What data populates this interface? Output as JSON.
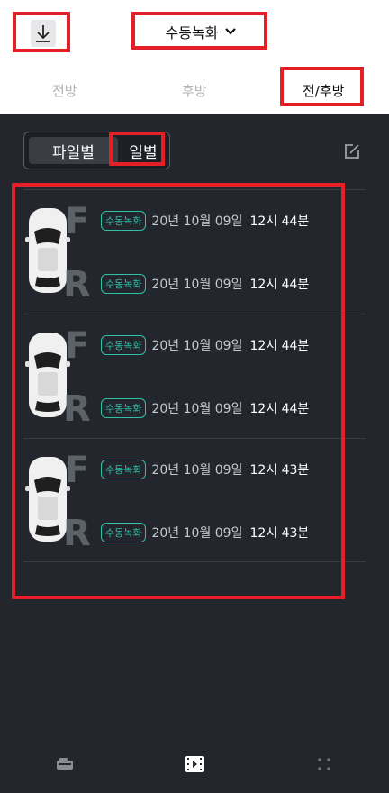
{
  "header": {
    "title": "수동녹화",
    "download_icon": "download-icon",
    "dropdown_icon": "chevron-down-icon"
  },
  "view_tabs": [
    {
      "label": "전방",
      "active": false
    },
    {
      "label": "후방",
      "active": false
    },
    {
      "label": "전/후방",
      "active": true
    }
  ],
  "segment": {
    "options": [
      "파일별",
      "일별"
    ],
    "selected": "파일별"
  },
  "edit_icon": "edit-icon",
  "camera_letters": {
    "front": "F",
    "rear": "R"
  },
  "recordings": [
    {
      "front": {
        "badge": "수동녹화",
        "date": "20년 10월 09일",
        "time": "12시 44분"
      },
      "rear": {
        "badge": "수동녹화",
        "date": "20년 10월 09일",
        "time": "12시 44분"
      }
    },
    {
      "front": {
        "badge": "수동녹화",
        "date": "20년 10월 09일",
        "time": "12시 44분"
      },
      "rear": {
        "badge": "수동녹화",
        "date": "20년 10월 09일",
        "time": "12시 44분"
      }
    },
    {
      "front": {
        "badge": "수동녹화",
        "date": "20년 10월 09일",
        "time": "12시 43분"
      },
      "rear": {
        "badge": "수동녹화",
        "date": "20년 10월 09일",
        "time": "12시 43분"
      }
    }
  ],
  "bottom_nav": [
    {
      "icon": "dashcam-icon",
      "active": false
    },
    {
      "icon": "video-file-icon",
      "active": true
    },
    {
      "icon": "grid-dots-icon",
      "active": false
    }
  ],
  "colors": {
    "accent": "#2fc0a7",
    "highlight": "#e51f26",
    "background": "#23262d"
  }
}
